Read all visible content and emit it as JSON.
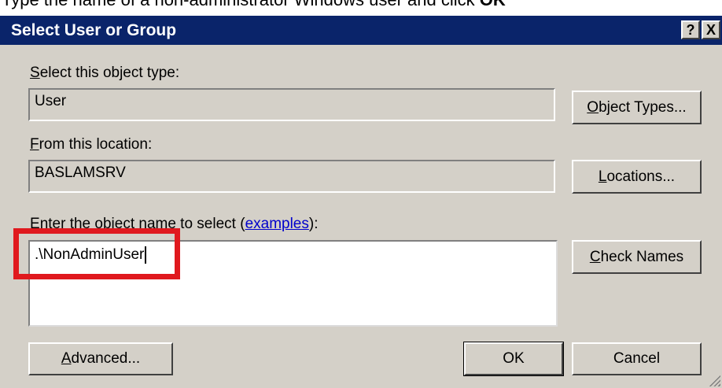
{
  "caption": {
    "text_before": "Type the name of a non-administrator Windows user and click ",
    "bold": "OK"
  },
  "window": {
    "title": "Select User or Group",
    "help_glyph": "?",
    "close_glyph": "X"
  },
  "object_type": {
    "label_accel": "S",
    "label_rest": "elect this object type:",
    "value": "User",
    "button_accel": "O",
    "button_rest": "bject Types..."
  },
  "location": {
    "label_accel": "F",
    "label_rest": "rom this location:",
    "value": "BASLAMSRV",
    "button_accel": "L",
    "button_rest": "ocations..."
  },
  "object_name": {
    "label_accel": "E",
    "label_rest": "nter the object name to select (",
    "link": "examples",
    "label_end": "):",
    "value": ".\\NonAdminUser"
  },
  "buttons": {
    "check_accel": "C",
    "check_rest": "heck Names",
    "advanced_accel": "A",
    "advanced_rest": "dvanced...",
    "ok": "OK",
    "cancel": "Cancel"
  },
  "colors": {
    "titlebar": "#0a246a",
    "dialog_face": "#d4d0c8",
    "highlight": "#e0191e",
    "link": "#0000cc"
  }
}
